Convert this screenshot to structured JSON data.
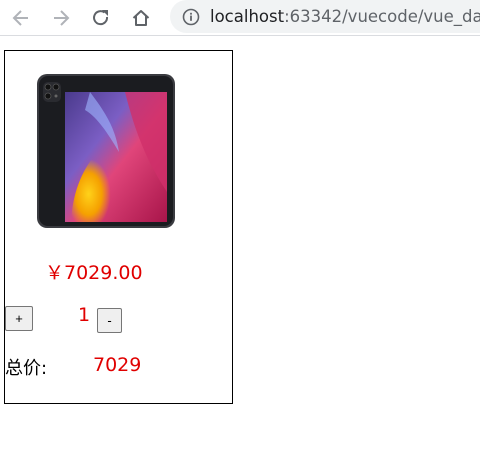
{
  "browser": {
    "url_host": "localhost",
    "url_rest": ":63342/vuecode/vue_da"
  },
  "product": {
    "price": "￥7029.00",
    "quantity": "1",
    "plus_label": "+",
    "minus_label": "-",
    "total_label": "总价:",
    "total_value": "7029"
  },
  "colors": {
    "price_red": "#e00000",
    "border": "#000000"
  }
}
